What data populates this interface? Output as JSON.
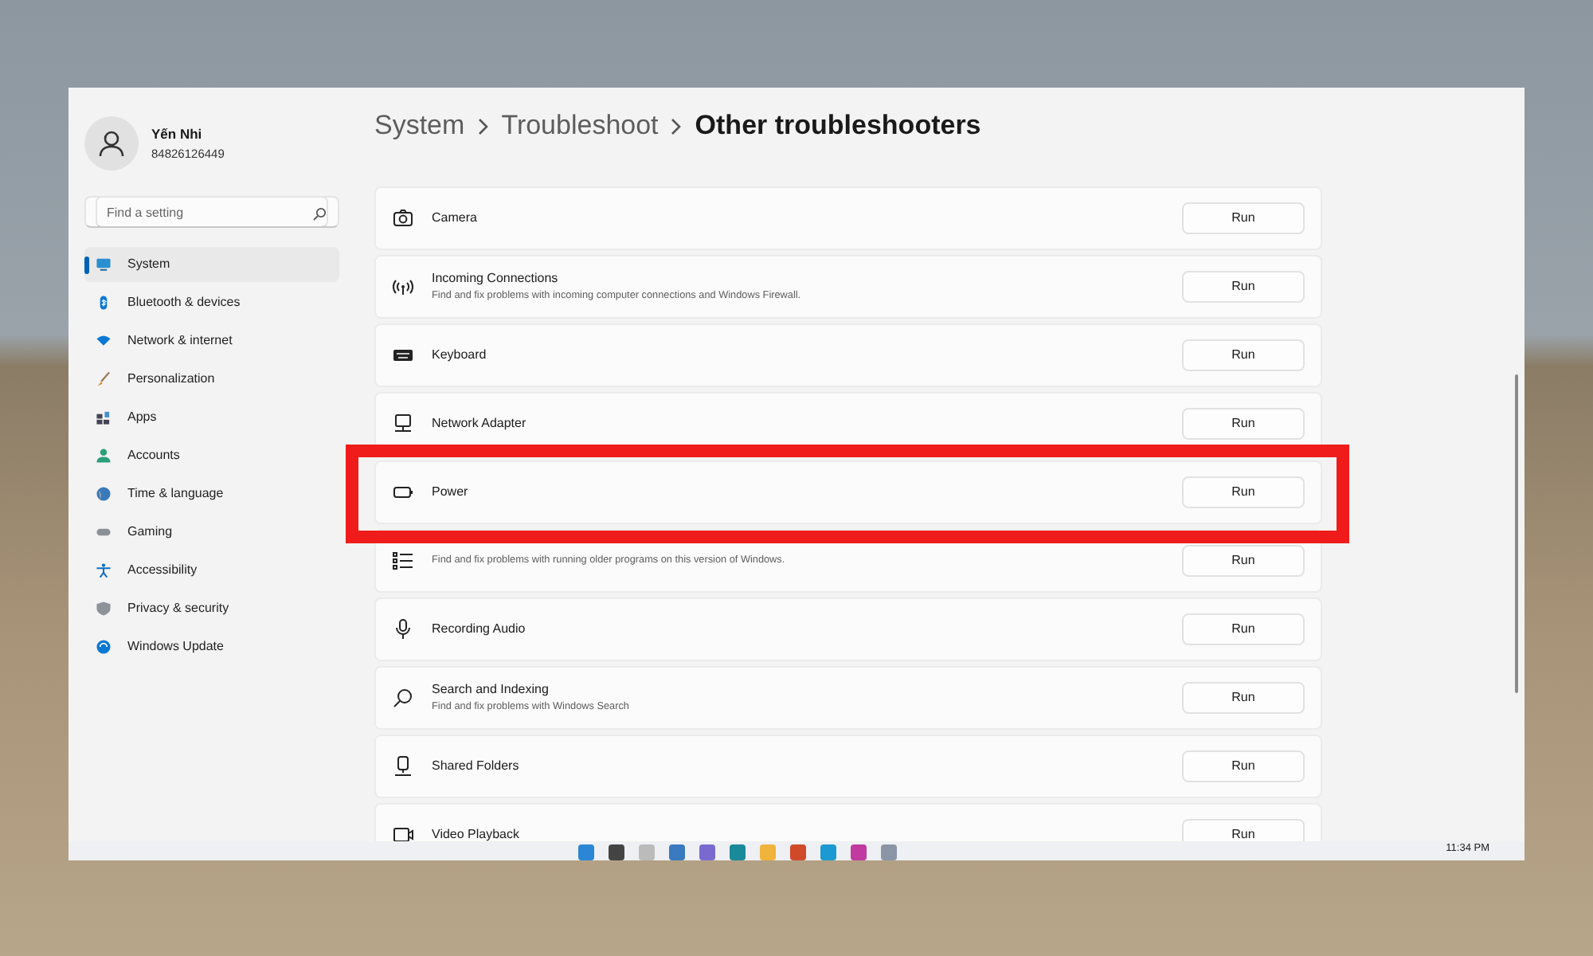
{
  "user": {
    "name": "Yến Nhi",
    "account": "84826126449"
  },
  "search": {
    "placeholder": "Find a setting"
  },
  "nav": [
    {
      "label": "System",
      "selected": true
    },
    {
      "label": "Bluetooth & devices",
      "selected": false
    },
    {
      "label": "Network & internet",
      "selected": false
    },
    {
      "label": "Personalization",
      "selected": false
    },
    {
      "label": "Apps",
      "selected": false
    },
    {
      "label": "Accounts",
      "selected": false
    },
    {
      "label": "Time & language",
      "selected": false
    },
    {
      "label": "Gaming",
      "selected": false
    },
    {
      "label": "Accessibility",
      "selected": false
    },
    {
      "label": "Privacy & security",
      "selected": false
    },
    {
      "label": "Windows Update",
      "selected": false
    }
  ],
  "breadcrumb": [
    {
      "label": "System",
      "current": false
    },
    {
      "label": "Troubleshoot",
      "current": false
    },
    {
      "label": "Other troubleshooters",
      "current": true
    }
  ],
  "troubleshooters": [
    {
      "title": "Camera",
      "button": "Run"
    },
    {
      "title": "Incoming Connections",
      "description": "Find and fix problems with incoming computer connections and Windows Firewall.",
      "button": "Run"
    },
    {
      "title": "Keyboard",
      "button": "Run"
    },
    {
      "title": "Network Adapter",
      "button": "Run"
    },
    {
      "title": "Power",
      "button": "Run"
    },
    {
      "description": "Find and fix problems with running older programs on this version of Windows.",
      "button": "Run"
    },
    {
      "title": "Recording Audio",
      "button": "Run"
    },
    {
      "title": "Search and Indexing",
      "description": "Find and fix problems with Windows Search",
      "button": "Run"
    },
    {
      "title": "Shared Folders",
      "button": "Run"
    },
    {
      "title": "Video Playback",
      "button": "Run"
    }
  ],
  "taskbar": {
    "time": "11:34 PM"
  }
}
